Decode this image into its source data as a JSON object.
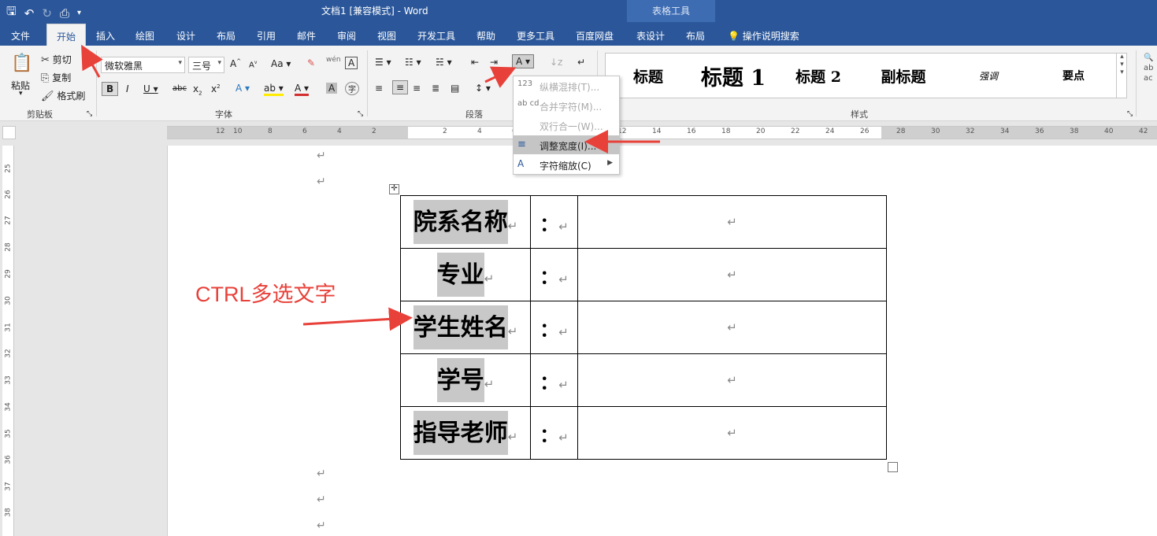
{
  "window": {
    "title": "文档1 [兼容模式]  -  Word",
    "context_group": "表格工具"
  },
  "tabs": [
    "文件",
    "开始",
    "插入",
    "绘图",
    "设计",
    "布局",
    "引用",
    "邮件",
    "审阅",
    "视图",
    "开发工具",
    "帮助",
    "更多工具",
    "百度网盘",
    "表设计",
    "布局"
  ],
  "active_tab": "开始",
  "tell_me": "操作说明搜索",
  "clipboard": {
    "paste": "粘贴",
    "cut": "剪切",
    "copy": "复制",
    "format_painter": "格式刷",
    "group_label": "剪贴板"
  },
  "font": {
    "name": "微软雅黑",
    "size": "三号",
    "group_label": "字体"
  },
  "paragraph": {
    "group_label": "段落"
  },
  "styles": {
    "items": [
      "标题",
      "标题 1",
      "标题 2",
      "副标题",
      "强调",
      "要点"
    ],
    "group_label": "样式"
  },
  "ruler": {
    "h_numbers": [
      "12",
      "10",
      "8",
      "6",
      "4",
      "2",
      "2",
      "4",
      "6",
      "8",
      "10",
      "12",
      "14",
      "16",
      "18",
      "20",
      "22",
      "24",
      "26",
      "28",
      "30",
      "32",
      "34",
      "36",
      "38",
      "40",
      "42"
    ],
    "v_numbers": [
      "25",
      "26",
      "27",
      "28",
      "29",
      "30",
      "31",
      "32",
      "33",
      "34",
      "35",
      "36",
      "37",
      "38",
      "39"
    ]
  },
  "menu": {
    "items": [
      {
        "icon": "123",
        "label": "纵横混排(T)...",
        "enabled": false
      },
      {
        "icon": "ab cd",
        "label": "合并字符(M)...",
        "enabled": false
      },
      {
        "icon": "",
        "label": "双行合一(W)...",
        "enabled": false
      },
      {
        "icon": "≡",
        "label": "调整宽度(I)...",
        "enabled": true
      },
      {
        "icon": "A",
        "label": "字符缩放(C)",
        "enabled": true
      }
    ]
  },
  "table": {
    "rows": [
      {
        "label": "院系名称",
        "colon": "："
      },
      {
        "label": "专业",
        "colon": "："
      },
      {
        "label": "学生姓名",
        "colon": "："
      },
      {
        "label": "学号",
        "colon": "："
      },
      {
        "label": "指导老师",
        "colon": "："
      }
    ],
    "return_mark": "↵"
  },
  "annotation": "CTRL多选文字",
  "colors": {
    "ribbon_blue": "#2b579a",
    "annotation_red": "#e8413a",
    "highlight_grey": "#c8c8c8"
  }
}
